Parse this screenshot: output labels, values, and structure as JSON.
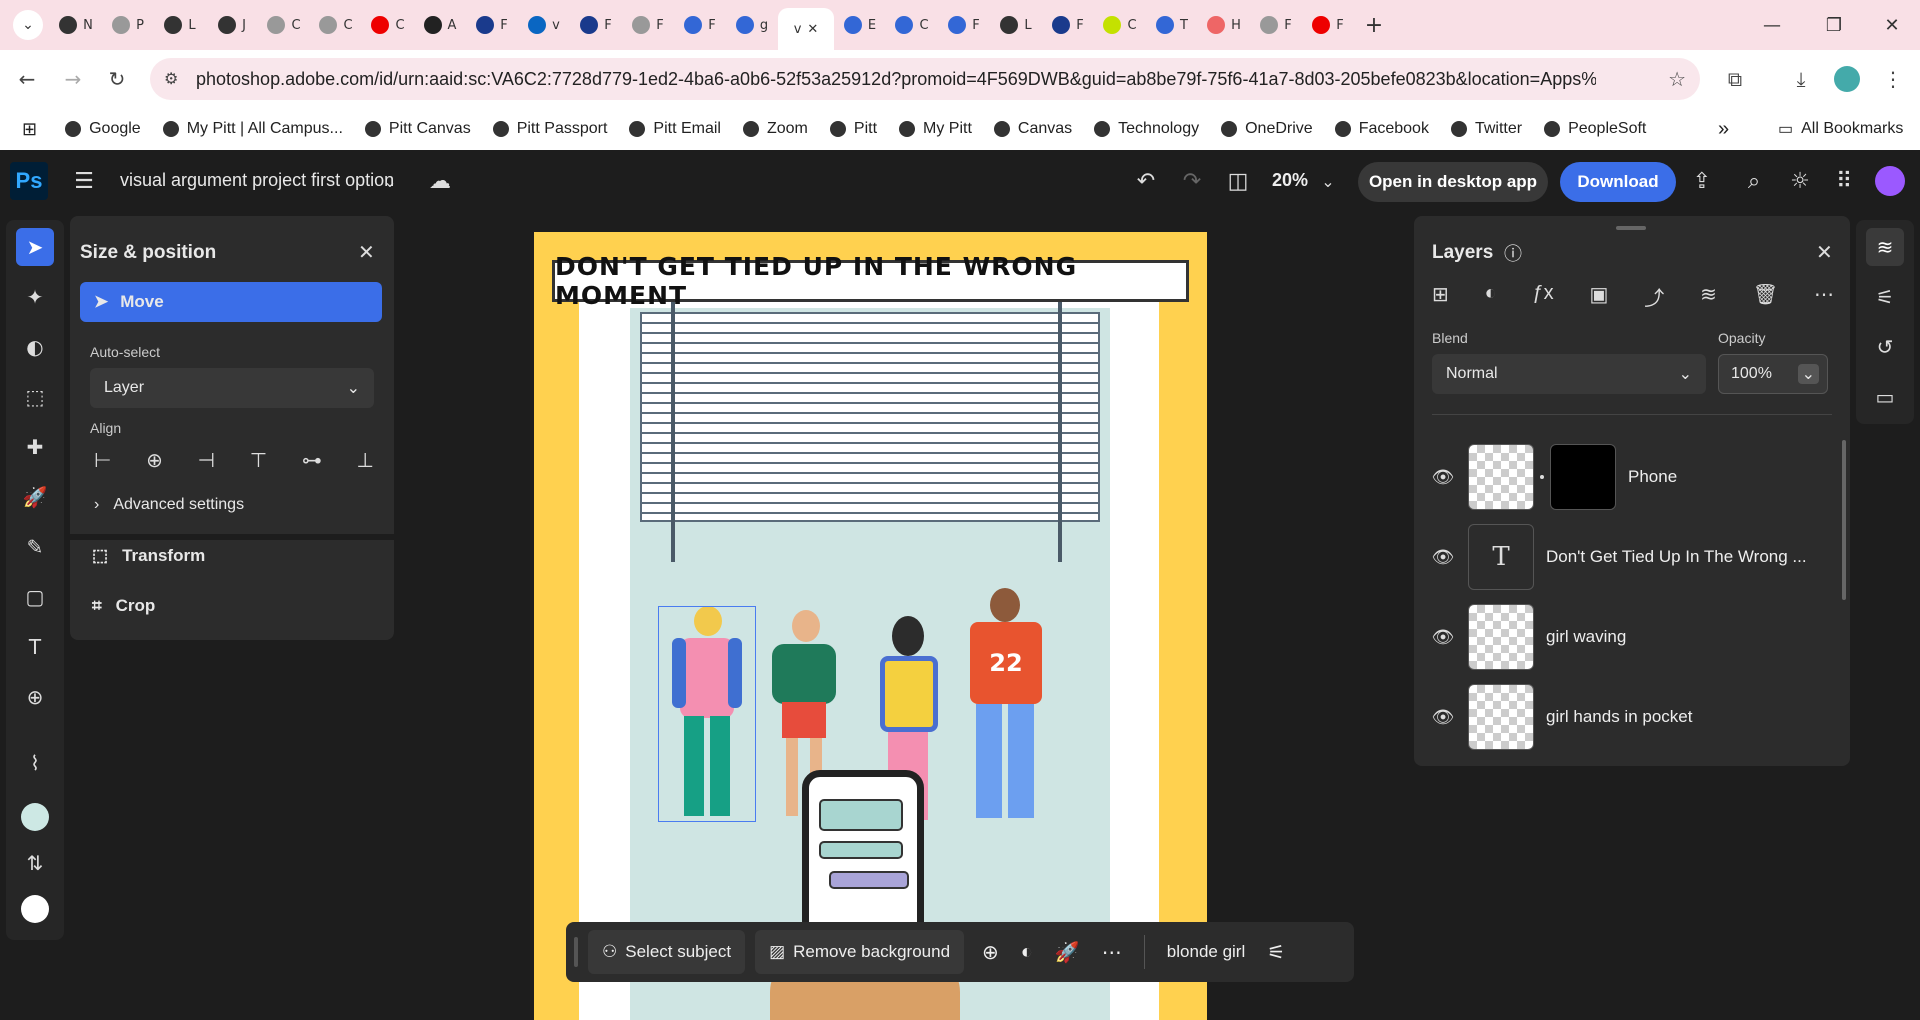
{
  "browser": {
    "tabs": [
      {
        "label": "N",
        "color": "#333"
      },
      {
        "label": "P",
        "color": "#999"
      },
      {
        "label": "L",
        "color": "#333"
      },
      {
        "label": "J",
        "color": "#333"
      },
      {
        "label": "C",
        "color": "#999"
      },
      {
        "label": "C",
        "color": "#999"
      },
      {
        "label": "C",
        "color": "#e00"
      },
      {
        "label": "A",
        "color": "#222"
      },
      {
        "label": "F",
        "color": "#1a3a8c"
      },
      {
        "label": "v",
        "color": "#0a66c2"
      },
      {
        "label": "F",
        "color": "#1a3a8c"
      },
      {
        "label": "F",
        "color": "#999"
      },
      {
        "label": "F",
        "color": "#3367d6"
      },
      {
        "label": "g",
        "color": "#3367d6"
      },
      {
        "label": "v",
        "color": "#fff",
        "active": true
      },
      {
        "label": "E",
        "color": "#3367d6"
      },
      {
        "label": "C",
        "color": "#3367d6"
      },
      {
        "label": "F",
        "color": "#3367d6"
      },
      {
        "label": "L",
        "color": "#333"
      },
      {
        "label": "F",
        "color": "#1a3a8c"
      },
      {
        "label": "C",
        "color": "#c4e100"
      },
      {
        "label": "T",
        "color": "#3367d6"
      },
      {
        "label": "H",
        "color": "#e66"
      },
      {
        "label": "F",
        "color": "#999"
      },
      {
        "label": "F",
        "color": "#e00"
      }
    ],
    "url": "photoshop.adobe.com/id/urn:aaid:sc:VA6C2:7728d779-1ed2-4ba6-a0b6-52f53a25912d?promoid=4F569DWB&guid=ab8be79f-75f6-41a7-8d03-205befe0823b&location=Apps%3APDP&...",
    "bookmarks": [
      "Google",
      "My Pitt | All Campus...",
      "Pitt Canvas",
      "Pitt Passport",
      "Pitt Email",
      "Zoom",
      "Pitt",
      "My Pitt",
      "Canvas",
      "Technology",
      "OneDrive",
      "Facebook",
      "Twitter",
      "PeopleSoft"
    ],
    "all_bookmarks": "All Bookmarks",
    "more_glyph": "»"
  },
  "ps": {
    "logo": "Ps",
    "doc_title": "visual argument project first option",
    "zoom": "20%",
    "open_desktop": "Open in desktop app",
    "download": "Download",
    "accent": "#3b6ee8"
  },
  "size_panel": {
    "title": "Size & position",
    "move": "Move",
    "auto_select_label": "Auto-select",
    "auto_select_value": "Layer",
    "align_label": "Align",
    "advanced": "Advanced settings",
    "transform": "Transform",
    "crop": "Crop"
  },
  "canvas": {
    "headline": "DON'T GET TIED UP IN THE WRONG MOMENT",
    "jersey_number": "22"
  },
  "bottom_bar": {
    "select_subject": "Select subject",
    "remove_background": "Remove background",
    "layer_name": "blonde girl"
  },
  "layers_panel": {
    "title": "Layers",
    "blend_label": "Blend",
    "blend_value": "Normal",
    "opacity_label": "Opacity",
    "opacity_value": "100%",
    "layers": [
      {
        "name": "Phone"
      },
      {
        "name": "Don't Get Tied Up In The Wrong ..."
      },
      {
        "name": "girl waving"
      },
      {
        "name": "girl hands in pocket"
      }
    ]
  }
}
